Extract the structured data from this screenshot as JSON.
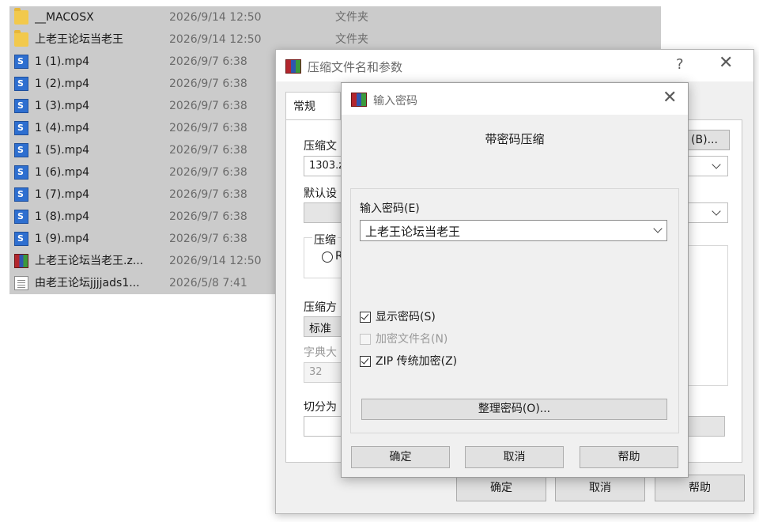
{
  "explorer": {
    "files": [
      {
        "name": "__MACOSX",
        "date": "2026/9/14 12:50",
        "type": "文件夹",
        "icon": "folder-icon"
      },
      {
        "name": "上老王论坛当老王",
        "date": "2026/9/14 12:50",
        "type": "文件夹",
        "icon": "folder-icon"
      },
      {
        "name": "1 (1).mp4",
        "date": "2026/9/7 6:38",
        "type": "",
        "icon": "video-icon"
      },
      {
        "name": "1 (2).mp4",
        "date": "2026/9/7 6:38",
        "type": "",
        "icon": "video-icon"
      },
      {
        "name": "1 (3).mp4",
        "date": "2026/9/7 6:38",
        "type": "",
        "icon": "video-icon"
      },
      {
        "name": "1 (4).mp4",
        "date": "2026/9/7 6:38",
        "type": "",
        "icon": "video-icon"
      },
      {
        "name": "1 (5).mp4",
        "date": "2026/9/7 6:38",
        "type": "",
        "icon": "video-icon"
      },
      {
        "name": "1 (6).mp4",
        "date": "2026/9/7 6:38",
        "type": "",
        "icon": "video-icon"
      },
      {
        "name": "1 (7).mp4",
        "date": "2026/9/7 6:38",
        "type": "",
        "icon": "video-icon"
      },
      {
        "name": "1 (8).mp4",
        "date": "2026/9/7 6:38",
        "type": "",
        "icon": "video-icon"
      },
      {
        "name": "1 (9).mp4",
        "date": "2026/9/7 6:38",
        "type": "",
        "icon": "video-icon"
      },
      {
        "name": "上老王论坛当老王.z...",
        "date": "2026/9/14 12:50",
        "type": "",
        "icon": "winrar-archive-icon"
      },
      {
        "name": "由老王论坛jjjjads1...",
        "date": "2026/5/8 7:41",
        "type": "",
        "icon": "text-file-icon"
      }
    ]
  },
  "outer_dialog": {
    "title": "压缩文件名和参数",
    "help_glyph": "?",
    "close_glyph": "✕",
    "tab_general": "常规",
    "archive_name_label": "压缩文",
    "archive_name_value": "1303.z",
    "browse_label": "(B)...",
    "default_profile_label": "默认设",
    "format_group_label": "压缩",
    "format_radio_label": "R",
    "method_label": "压缩方",
    "method_value": "标准",
    "dict_label": "字典大",
    "dict_value": "32",
    "split_label": "切分为",
    "ok": "确定",
    "cancel": "取消",
    "help": "帮助"
  },
  "password_dialog": {
    "title": "输入密码",
    "close_glyph": "✕",
    "heading": "带密码压缩",
    "password_label": "输入密码(E)",
    "password_value": "上老王论坛当老王",
    "show_password": {
      "label": "显示密码(S)",
      "checked": true
    },
    "encrypt_filenames": {
      "label": "加密文件名(N)",
      "checked": false,
      "disabled": true
    },
    "zip_legacy": {
      "label": "ZIP 传统加密(Z)",
      "checked": true
    },
    "organize_button": "整理密码(O)...",
    "ok": "确定",
    "cancel": "取消",
    "help": "帮助"
  }
}
